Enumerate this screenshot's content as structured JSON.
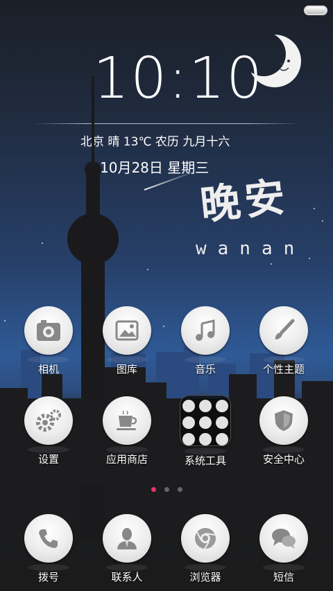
{
  "lockscreen": {
    "time_hour": "10",
    "time_min": "10",
    "weather": "北京 晴 13℃    农历 九月十六",
    "date": "10月28日   星期三",
    "greeting_zh": "晚安",
    "greeting_en": "wanan"
  },
  "apps_row1": [
    {
      "label": "相机",
      "icon": "camera-icon"
    },
    {
      "label": "图库",
      "icon": "gallery-icon"
    },
    {
      "label": "音乐",
      "icon": "music-icon"
    },
    {
      "label": "个性主题",
      "icon": "theme-brush-icon"
    }
  ],
  "apps_row2": [
    {
      "label": "设置",
      "icon": "settings-gear-icon"
    },
    {
      "label": "应用商店",
      "icon": "app-store-cup-icon"
    },
    {
      "label": "系统工具",
      "icon": "folder-icon"
    },
    {
      "label": "安全中心",
      "icon": "shield-icon"
    }
  ],
  "dock": [
    {
      "label": "拨号",
      "icon": "phone-icon"
    },
    {
      "label": "联系人",
      "icon": "contacts-icon"
    },
    {
      "label": "浏览器",
      "icon": "browser-icon"
    },
    {
      "label": "短信",
      "icon": "message-icon"
    }
  ],
  "page_indicator": {
    "pages": 3,
    "active": 1,
    "active_color": "#e8336b"
  }
}
